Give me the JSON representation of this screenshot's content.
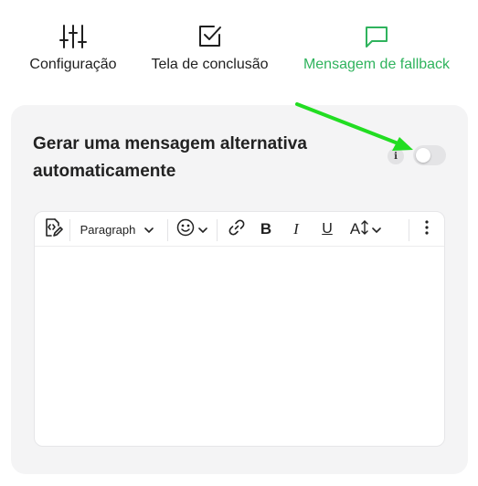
{
  "tabs": [
    {
      "label": "Configuração",
      "icon": "sliders-icon",
      "active": false
    },
    {
      "label": "Tela de conclusão",
      "icon": "checkbox-icon",
      "active": false
    },
    {
      "label": "Mensagem de fallback",
      "icon": "chat-bubble-icon",
      "active": true
    }
  ],
  "panel": {
    "title": "Gerar uma mensagem alternativa automaticamente",
    "info_badge": "i",
    "toggle_on": false
  },
  "toolbar": {
    "paragraph_label": "Paragraph",
    "bold_label": "B",
    "italic_label": "I",
    "underline_label": "U",
    "text_size_label": "A"
  },
  "colors": {
    "accent": "#2fb35d",
    "panel_bg": "#f4f4f5",
    "arrow": "#22dd22"
  }
}
